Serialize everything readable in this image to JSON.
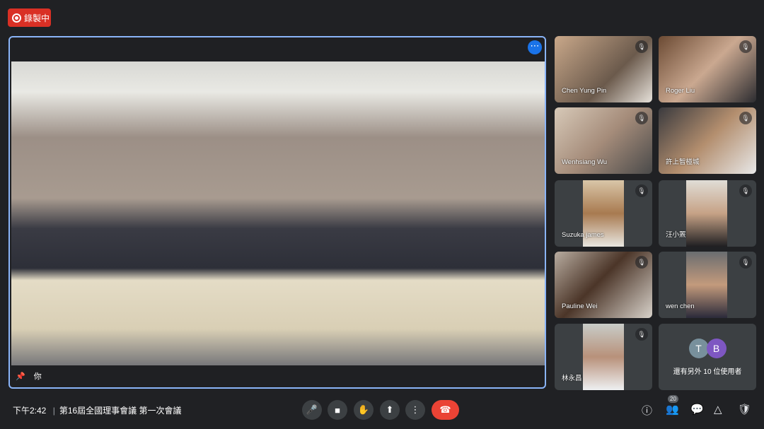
{
  "recording": {
    "label": "錄製中",
    "icon": "record-icon",
    "color": "#d93025"
  },
  "main_tile": {
    "name": "你",
    "pin_icon": "pin-icon",
    "more_icon": "more-options-icon"
  },
  "participants": [
    {
      "name": "Chen Yung Pin",
      "muted": true
    },
    {
      "name": "Roger Liu",
      "muted": true
    },
    {
      "name": "Wenhsiang Wu",
      "muted": true
    },
    {
      "name": "許上智椪城",
      "muted": true
    },
    {
      "name": "Suzuka james",
      "muted": true
    },
    {
      "name": "汪小罴",
      "muted": true
    },
    {
      "name": "Pauline Wei",
      "muted": true
    },
    {
      "name": "wen chen",
      "muted": true
    },
    {
      "name": "林永昌",
      "muted": true
    }
  ],
  "others": {
    "avatars": [
      {
        "letter": "T",
        "color": "#78909c"
      },
      {
        "letter": "B",
        "color": "#7e57c2"
      }
    ],
    "label": "還有另外 10 位使用者"
  },
  "bottom_bar": {
    "time": "下午2:42",
    "separator": "|",
    "meeting_title": "第16屆全國理事會議 第一次會議",
    "people_count": "20"
  }
}
